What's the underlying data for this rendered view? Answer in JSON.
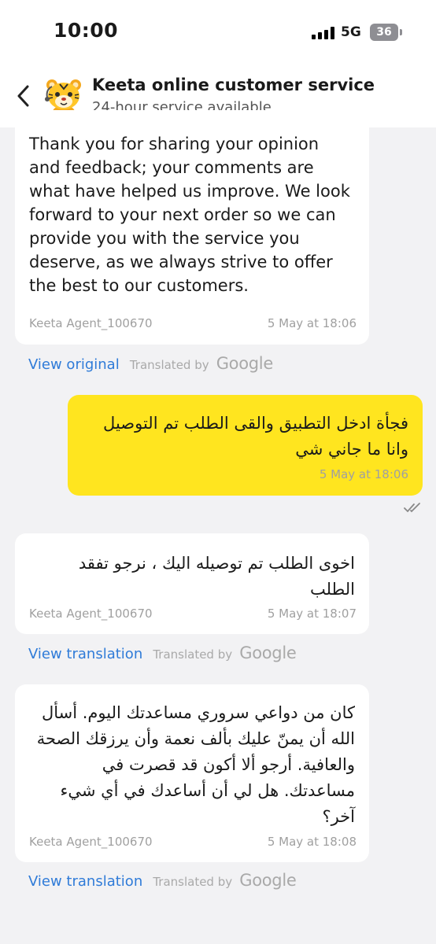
{
  "status_bar": {
    "time": "10:00",
    "network": "5G",
    "battery": "36"
  },
  "header": {
    "title": "Keeta online customer service",
    "subtitle": "24-hour service available",
    "avatar_icon": "tiger-mascot-icon",
    "back_icon": "chevron-left-icon"
  },
  "messages": [
    {
      "role": "agent",
      "text": "Thank you for sharing your opinion and feedback; your comments are what have helped us improve. We look forward to your next order so we can provide you with the service you deserve, as we always strive to offer the best to our customers.",
      "sender": "Keeta Agent_100670",
      "time": "5 May at 18:06",
      "translation_action": "View original",
      "translated_by": "Translated by",
      "provider": "Google"
    },
    {
      "role": "user",
      "text": "فجأة ادخل التطبيق والقى الطلب تم التوصيل وانا ما جاني شي",
      "time": "5 May at 18:06",
      "status_icon": "double-check-icon"
    },
    {
      "role": "agent",
      "text": "اخوى  الطلب تم توصيله اليك ، نرجو تفقد الطلب",
      "sender": "Keeta Agent_100670",
      "time": "5 May at 18:07",
      "translation_action": "View translation",
      "translated_by": "Translated by",
      "provider": "Google"
    },
    {
      "role": "agent",
      "text": "كان من دواعي سروري مساعدتك اليوم. أسأل الله أن يمنّ عليك بألف نعمة وأن يرزقك الصحة والعافية. أرجو ألا أكون قد قصرت في مساعدتك. هل لي أن أساعدك في أي شيء آخر؟",
      "sender": "Keeta Agent_100670",
      "time": "5 May at 18:08",
      "translation_action": "View translation",
      "translated_by": "Translated by",
      "provider": "Google"
    }
  ],
  "colors": {
    "background": "#f2f2f4",
    "user_bubble": "#ffe51f",
    "agent_bubble": "#ffffff",
    "link": "#2f7bd8",
    "meta_text": "#a0a0a0"
  }
}
